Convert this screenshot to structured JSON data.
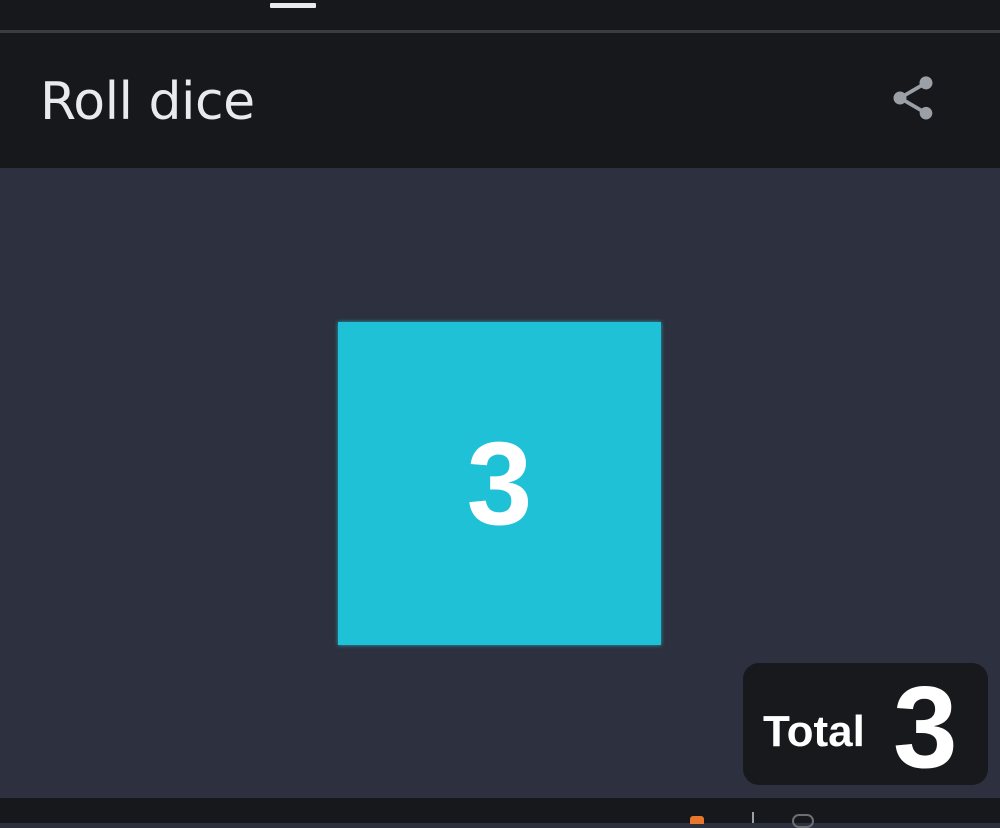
{
  "header": {
    "title": "Roll dice",
    "share_icon": "share-icon"
  },
  "dice": [
    {
      "value": "3",
      "color": "#1fc1d6"
    }
  ],
  "total": {
    "label": "Total",
    "value": "3"
  },
  "colors": {
    "header_bg": "#17181c",
    "content_bg": "#2d303e",
    "die": "#1fc1d6",
    "total_bg": "#18191d",
    "text": "#ffffff"
  }
}
